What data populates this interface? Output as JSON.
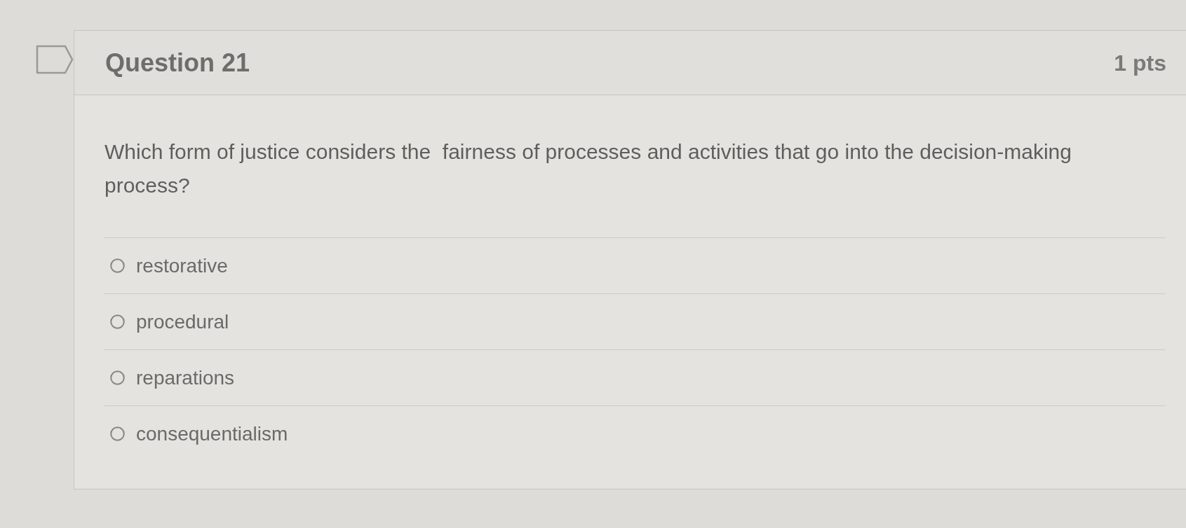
{
  "question": {
    "title": "Question 21",
    "points": "1 pts",
    "flagged": false,
    "text": "Which form of justice considers the  fairness of processes and activities that go into the decision-making process?"
  },
  "options": [
    {
      "label": "restorative",
      "selected": false
    },
    {
      "label": "procedural",
      "selected": false
    },
    {
      "label": "reparations",
      "selected": false
    },
    {
      "label": "consequentialism",
      "selected": false
    }
  ]
}
